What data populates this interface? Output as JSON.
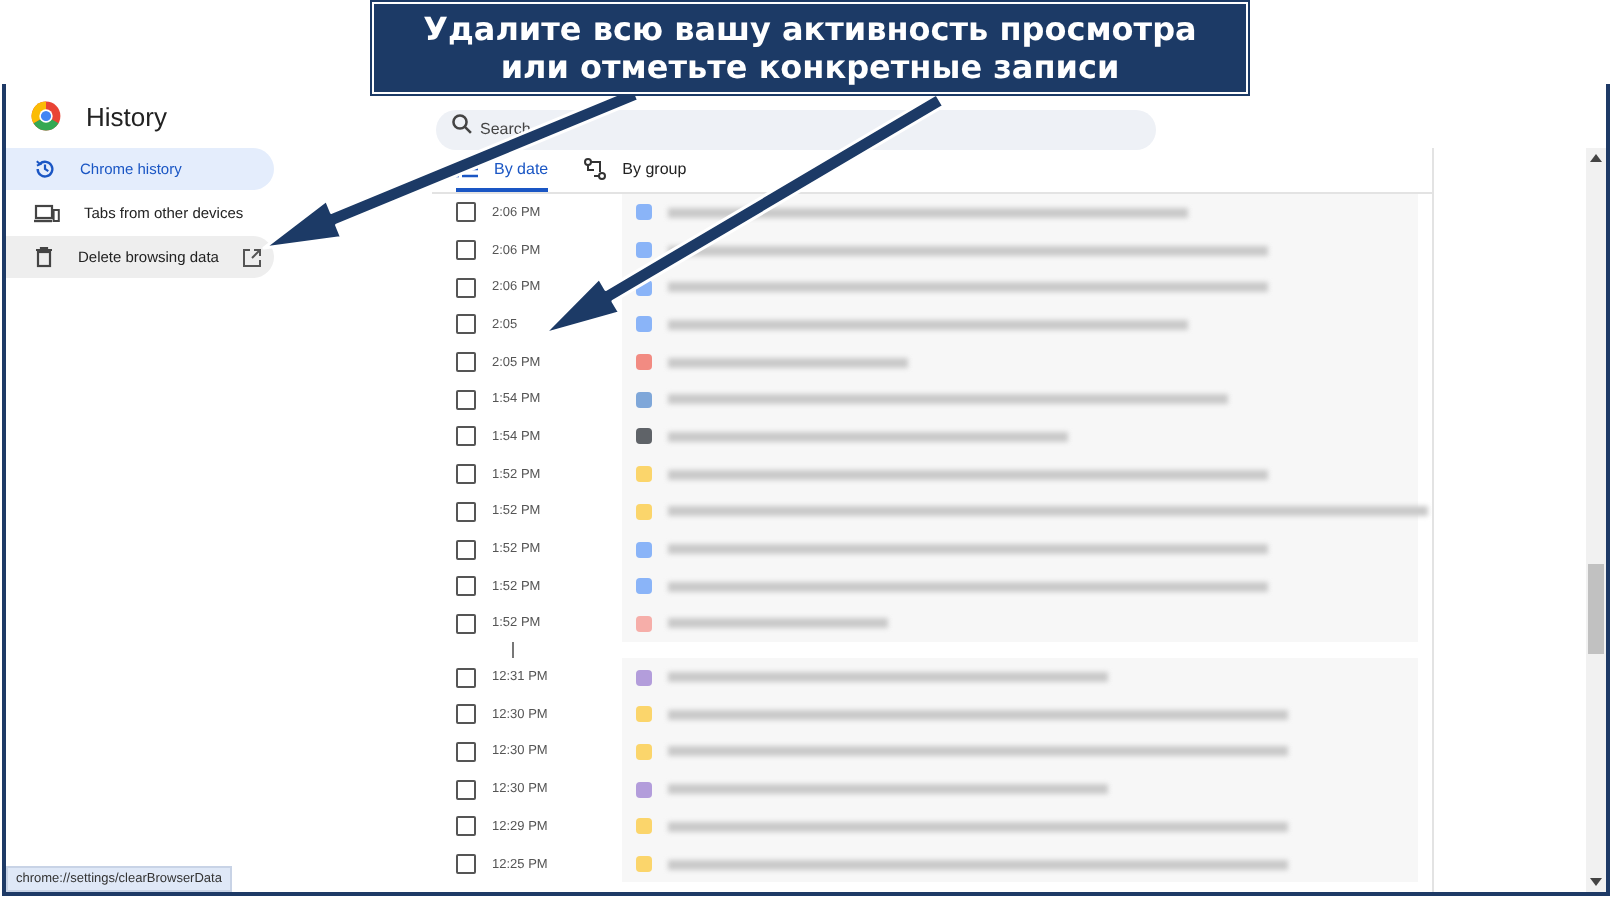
{
  "banner": {
    "lines": [
      "Удалите всю вашу активность просмотра",
      "или отметьте конкретные записи"
    ]
  },
  "header": {
    "title": "History",
    "search": {
      "placeholder": "Search"
    }
  },
  "sidebar": {
    "items": [
      {
        "label": "Chrome history",
        "selected": true,
        "external": false
      },
      {
        "label": "Tabs from other devices",
        "selected": false,
        "external": false
      },
      {
        "label": "Delete browsing data",
        "selected": false,
        "external": true
      }
    ]
  },
  "tabs": [
    {
      "label": "By date",
      "selected": true
    },
    {
      "label": "By group",
      "selected": false
    }
  ],
  "rows": [
    {
      "kind": "entry",
      "time": "2:06 PM",
      "checked": false,
      "color": "#8ab4f8"
    },
    {
      "kind": "entry",
      "time": "2:06 PM",
      "checked": false,
      "color": "#8ab4f8"
    },
    {
      "kind": "entry",
      "time": "2:06 PM",
      "checked": false,
      "color": "#8ab4f8"
    },
    {
      "kind": "entry",
      "time": "2:05",
      "checked": false,
      "color": "#8ab4f8"
    },
    {
      "kind": "entry",
      "time": "2:05 PM",
      "checked": false,
      "color": "#f28b82"
    },
    {
      "kind": "entry",
      "time": "1:54 PM",
      "checked": false,
      "color": "#7fa7d9"
    },
    {
      "kind": "entry",
      "time": "1:54 PM",
      "checked": false,
      "color": "#5f6368"
    },
    {
      "kind": "entry",
      "time": "1:52 PM",
      "checked": false,
      "color": "#fbd56b"
    },
    {
      "kind": "entry",
      "time": "1:52 PM",
      "checked": false,
      "color": "#fbd56b"
    },
    {
      "kind": "entry",
      "time": "1:52 PM",
      "checked": false,
      "color": "#8ab4f8"
    },
    {
      "kind": "entry",
      "time": "1:52 PM",
      "checked": false,
      "color": "#8ab4f8"
    },
    {
      "kind": "entry",
      "time": "1:52 PM",
      "checked": false,
      "color": "#f6aea9"
    },
    {
      "kind": "gap"
    },
    {
      "kind": "entry",
      "time": "12:31 PM",
      "checked": false,
      "color": "#b39ddb"
    },
    {
      "kind": "entry",
      "time": "12:30 PM",
      "checked": false,
      "color": "#fbd56b"
    },
    {
      "kind": "entry",
      "time": "12:30 PM",
      "checked": false,
      "color": "#fbd56b"
    },
    {
      "kind": "entry",
      "time": "12:30 PM",
      "checked": false,
      "color": "#b39ddb"
    },
    {
      "kind": "entry",
      "time": "12:29 PM",
      "checked": false,
      "color": "#fbd56b"
    },
    {
      "kind": "entry",
      "time": "12:25 PM",
      "checked": false,
      "color": "#fbd56b"
    }
  ],
  "status_bar": {
    "url": "chrome://settings/clearBrowserData"
  }
}
